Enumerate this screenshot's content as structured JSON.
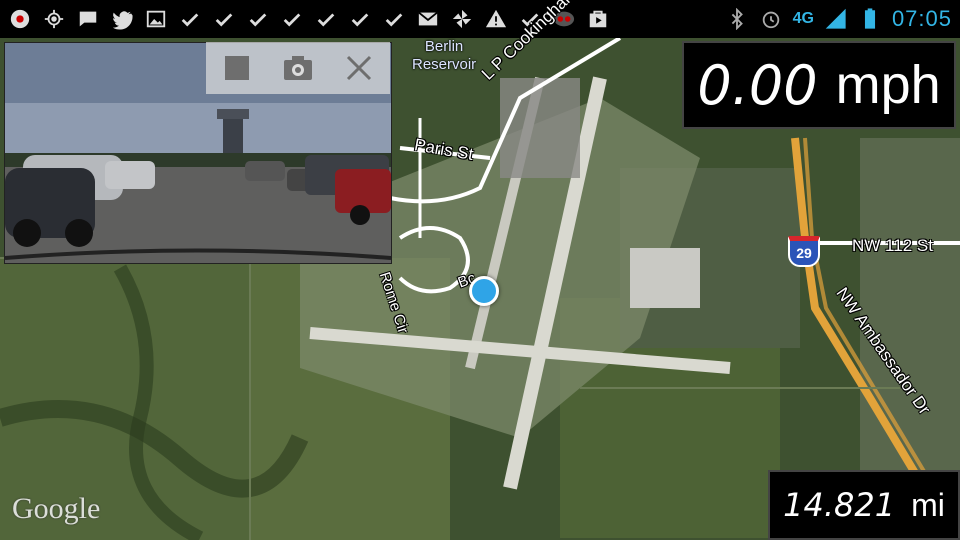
{
  "statusbar": {
    "left_icons": [
      "record-icon",
      "gps-icon",
      "chat-icon",
      "twitter-icon",
      "image-icon",
      "check-icon",
      "check-icon",
      "check-icon",
      "check-icon",
      "check-icon",
      "check-icon",
      "check-icon",
      "gmail-icon",
      "pinwheel-icon",
      "warning-icon",
      "check-icon",
      "voicemail-icon",
      "play-store-icon"
    ],
    "network_label": "4G",
    "time": "07:05"
  },
  "camera": {
    "toolbar": {
      "stop_icon": "stop-icon",
      "camera_icon": "camera-icon",
      "close_icon": "close-icon"
    }
  },
  "speed": {
    "value": "0.00",
    "unit": "mph"
  },
  "distance": {
    "value": "14.821",
    "unit": "mi"
  },
  "map": {
    "labels": {
      "berlin": "Berlin",
      "reservoir": "Reservoir",
      "cookingham": "L P Cookingham Dr",
      "paris": "Paris St",
      "rome": "Rome Cir",
      "nw112": "NW 112 St",
      "ambassador": "NW Ambassador Dr",
      "bc": "Bc",
      "shield": "29"
    },
    "attribution": "Google"
  },
  "colors": {
    "accent": "#33b5e5",
    "location": "#2fa4e7",
    "highway": "#e2a33a"
  }
}
